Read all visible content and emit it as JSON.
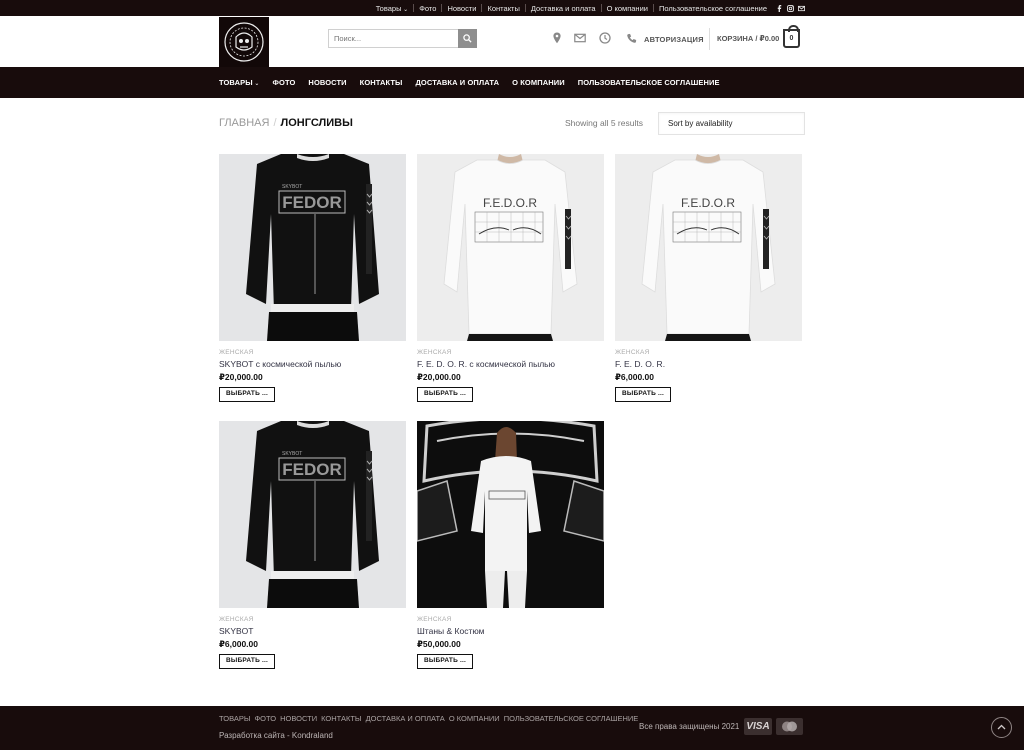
{
  "topbar": {
    "items": [
      "Товары",
      "Фото",
      "Новости",
      "Контакты",
      "Доставка и оплата",
      "О компании",
      "Пользовательское соглашение"
    ],
    "social": [
      "facebook-icon",
      "instagram-icon",
      "mail-icon"
    ]
  },
  "header": {
    "search_placeholder": "Поиск...",
    "auth_label": "АВТОРИЗАЦИЯ",
    "cart_label": "КОРЗИНА / ₽0.00",
    "cart_count": "0"
  },
  "nav": {
    "items": [
      "ТОВАРЫ",
      "ФОТО",
      "НОВОСТИ",
      "КОНТАКТЫ",
      "ДОСТАВКА И ОПЛАТА",
      "О КОМПАНИИ",
      "ПОЛЬЗОВАТЕЛЬСКОЕ СОГЛАШЕНИЕ"
    ]
  },
  "breadcrumb": {
    "home": "Главная",
    "separator": "/",
    "current": "Лонгсливы"
  },
  "results_text": "Showing all 5 results",
  "sort": {
    "selected": "Sort by availability"
  },
  "products": [
    {
      "category": "ЖЕНСКАЯ",
      "name": "SKYBOT с космической пылью",
      "price": "₽20,000.00",
      "button": "ВЫБРАТЬ ...",
      "image": "black-longsleeve-fedor"
    },
    {
      "category": "ЖЕНСКАЯ",
      "name": "F. E. D. O. R. с космической пылью",
      "price": "₽20,000.00",
      "button": "ВЫБРАТЬ ...",
      "image": "white-longsleeve-fedor"
    },
    {
      "category": "ЖЕНСКАЯ",
      "name": "F. E. D. O. R.",
      "price": "₽6,000.00",
      "button": "ВЫБРАТЬ ...",
      "image": "white-longsleeve-fedor"
    },
    {
      "category": "ЖЕНСКАЯ",
      "name": "SKYBOT",
      "price": "₽6,000.00",
      "button": "ВЫБРАТЬ ...",
      "image": "black-longsleeve-fedor"
    },
    {
      "category": "ЖЕНСКАЯ",
      "name": "Штаны & Костюм",
      "price": "₽50,000.00",
      "button": "ВЫБРАТЬ ...",
      "image": "runway-white-suit"
    }
  ],
  "image_labels": {
    "fedor_text": "F.E.D.O.R",
    "fedor_black_text": "FEDOR",
    "skybot_text": "SKYBOT"
  },
  "footer": {
    "nav": [
      "Товары",
      "Фото",
      "Новости",
      "Контакты",
      "Доставка и оплата",
      "О компании",
      "Пользовательское соглашение"
    ],
    "credit": "Разработка сайта - Kondraland",
    "rights": "Все права защищены 2021",
    "payment": [
      "VISA",
      "mastercard-icon"
    ]
  },
  "colors": {
    "dark": "#180c0c",
    "accent_gray": "#8e8e8e"
  }
}
